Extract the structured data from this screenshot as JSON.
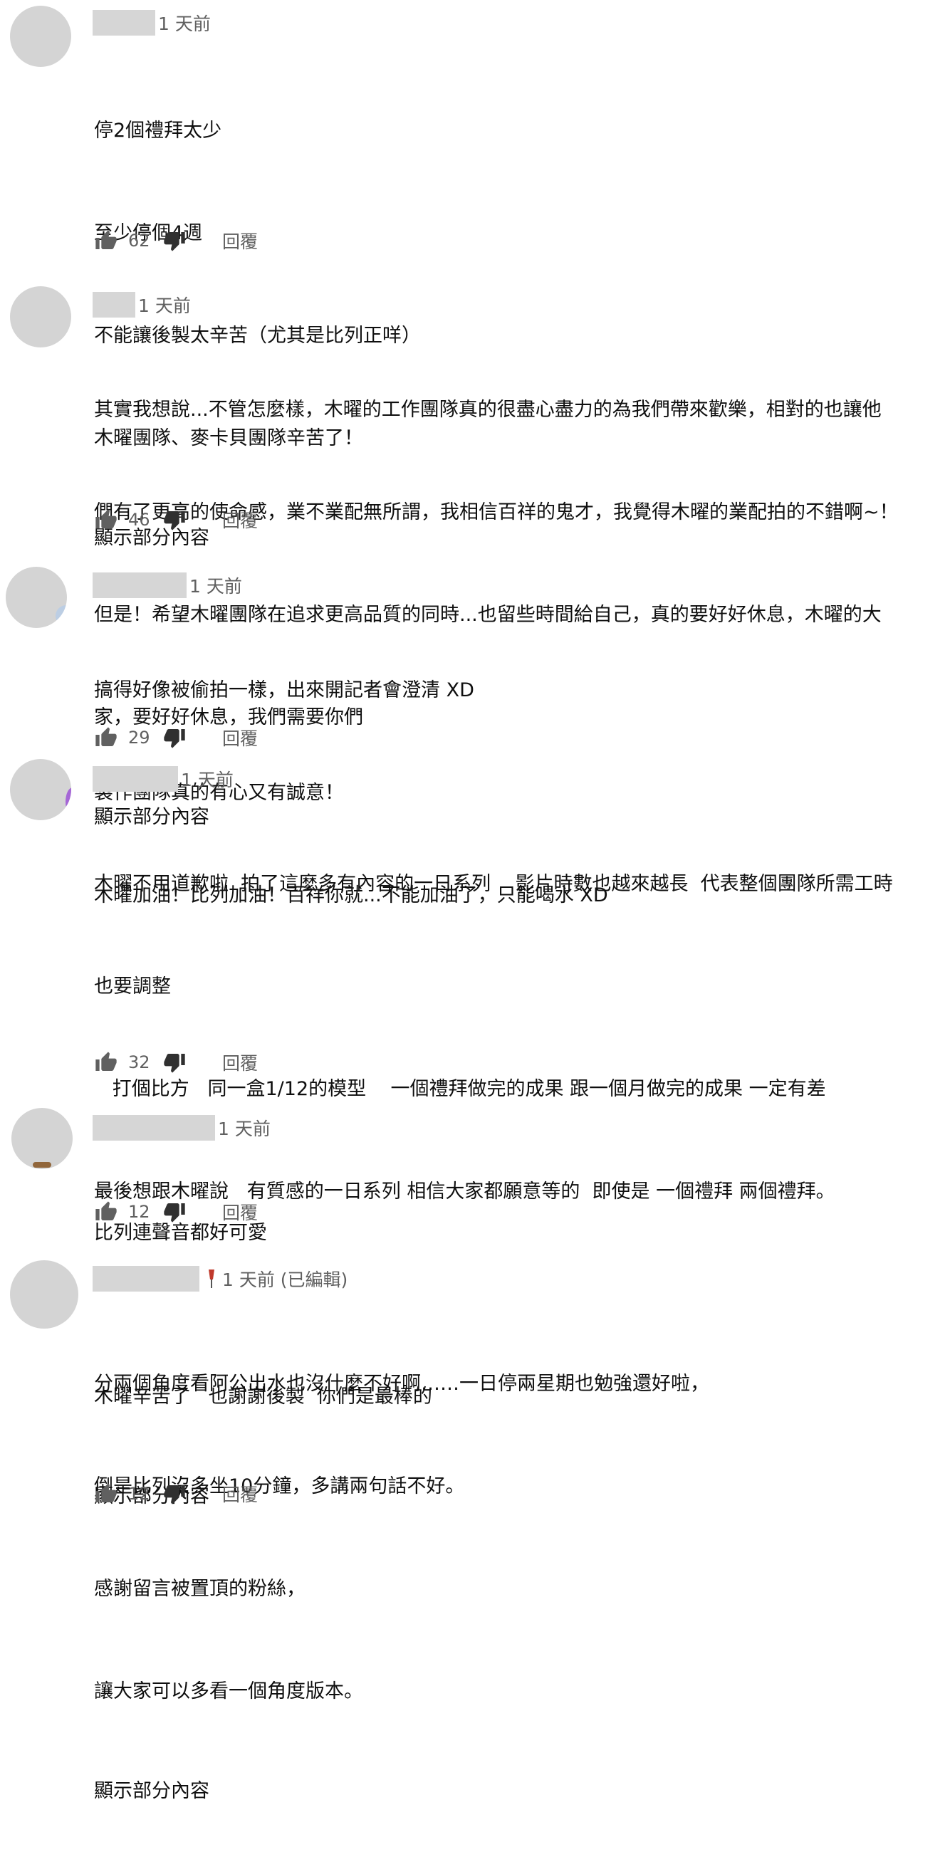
{
  "labels": {
    "reply": "回覆",
    "show_less": "顯示部分內容"
  },
  "comments": [
    {
      "time": "1 天前",
      "lines": [
        "停2個禮拜太少",
        "至少停個4週",
        "不能讓後製太辛苦（尤其是比列正咩）",
        "木曜團隊、麥卡貝團隊辛苦了！"
      ],
      "likes": "62"
    },
    {
      "time": "1 天前",
      "lines": [
        "其實我想說...不管怎麼樣，木曜的工作團隊真的很盡心盡力的為我們帶來歡樂，相對的也讓他",
        "們有了更高的使命感，業不業配無所謂，我相信百祥的鬼才，我覺得木曜的業配拍的不錯啊~！",
        "但是！希望木曜團隊在追求更高品質的同時...也留些時間給自己，真的要好好休息，木曜的大",
        "家，要好好休息，我們需要你們"
      ],
      "likes": "46"
    },
    {
      "time": "1 天前",
      "lines": [
        "搞得好像被偷拍一樣，出來開記者會澄清 XD",
        "製作團隊真的有心又有誠意！",
        "木曜加油！比列加油！百祥你就...不能加油了，只能喝水 XD"
      ],
      "likes": "29"
    },
    {
      "time": "1 天前",
      "lines": [
        "木曜不用道歉啦  拍了這麼多有內容的一日系列    影片時數也越來越長  代表整個團隊所需工時",
        "也要調整",
        "   打個比方   同一盒1/12的模型    一個禮拜做完的成果 跟一個月做完的成果 一定有差",
        "最後想跟木曜說   有質感的一日系列 相信大家都願意等的  即使是 一個禮拜 兩個禮拜。",
        "",
        "木曜辛苦了   也謝謝後製  你們是最棒的"
      ],
      "likes": "32"
    },
    {
      "time": "1 天前",
      "lines": [
        "比列連聲音都好可愛"
      ],
      "likes": "12"
    },
    {
      "time": "1 天前 (已編輯)",
      "lines": [
        "分兩個角度看阿公出水也沒什麼不好啊……一日停兩星期也勉強還好啦，",
        "倒是比列沒多坐10分鐘，多講兩句話不好。",
        "感謝留言被置頂的粉絲，",
        "讓大家可以多看一個角度版本。"
      ],
      "likes": "12"
    }
  ],
  "colors": {
    "text": "#0f0f0f",
    "secondary": "#606060",
    "placeholder": "#d4d4d4"
  }
}
